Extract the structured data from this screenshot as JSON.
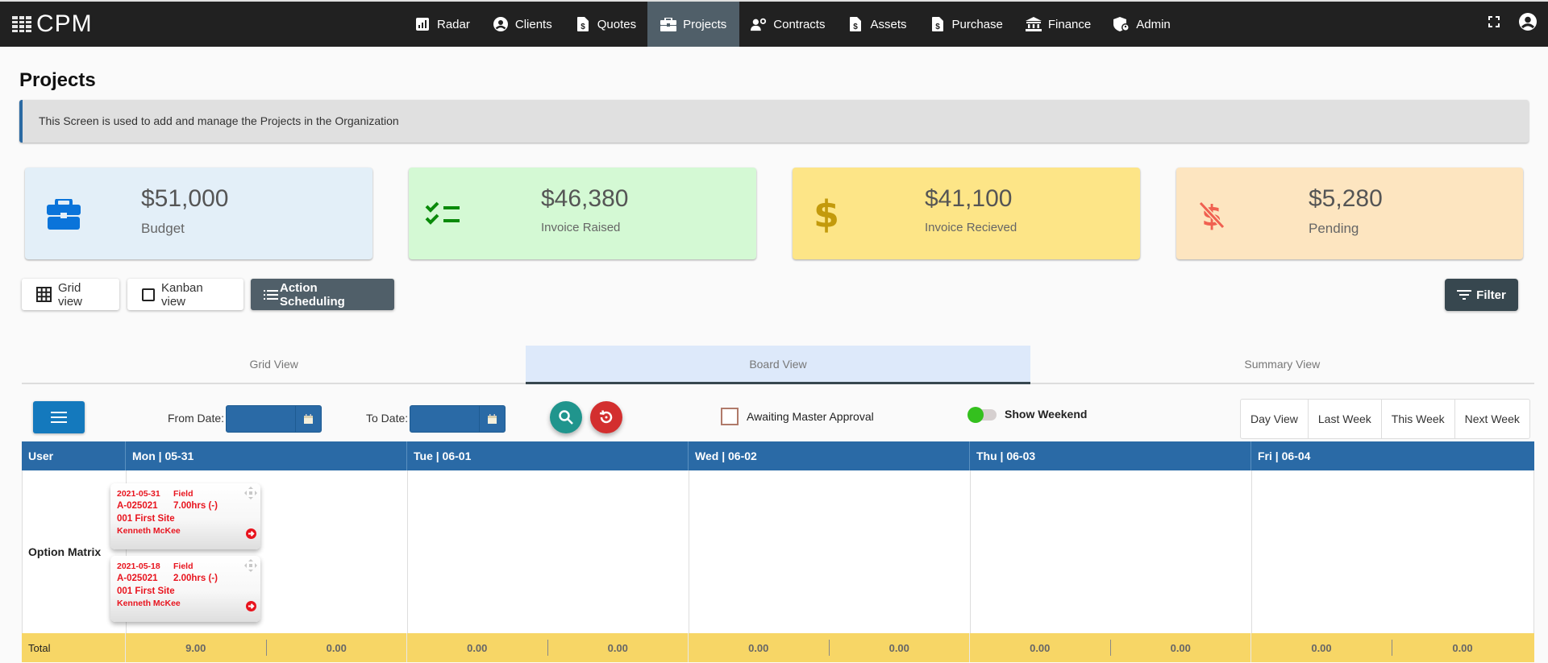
{
  "app": {
    "logo_text": "CPM"
  },
  "nav": {
    "items": [
      {
        "label": "Radar",
        "icon": "chart-icon"
      },
      {
        "label": "Clients",
        "icon": "user-circle-icon"
      },
      {
        "label": "Quotes",
        "icon": "invoice-dollar-icon"
      },
      {
        "label": "Projects",
        "icon": "briefcase-icon",
        "active": true
      },
      {
        "label": "Contracts",
        "icon": "users-cog-icon"
      },
      {
        "label": "Assets",
        "icon": "invoice-dollar-icon"
      },
      {
        "label": "Purchase",
        "icon": "invoice-dollar-icon"
      },
      {
        "label": "Finance",
        "icon": "bank-icon"
      },
      {
        "label": "Admin",
        "icon": "shield-user-icon"
      }
    ],
    "right": {
      "fullscreen_icon": "fullscreen-icon",
      "account_icon": "user-circle-icon"
    }
  },
  "page": {
    "title": "Projects",
    "info": "This Screen is used to add and manage the Projects in the Organization"
  },
  "stats": [
    {
      "value": "$51,000",
      "label": "Budget",
      "icon": "briefcase-icon",
      "color": "#0a74da"
    },
    {
      "value": "$46,380",
      "label": "Invoice Raised",
      "icon": "tasks-icon",
      "color": "#0a8a0a"
    },
    {
      "value": "$41,100",
      "label": "Invoice Recieved",
      "icon": "dollar-icon",
      "color": "#c39a0c"
    },
    {
      "value": "$5,280",
      "label": "Pending",
      "icon": "no-dollar-icon",
      "color": "#f06050"
    }
  ],
  "view_buttons": {
    "grid": "Grid view",
    "kanban": "Kanban view",
    "action": "Action Scheduling",
    "filter": "Filter"
  },
  "tabs": [
    {
      "label": "Grid View",
      "active": false
    },
    {
      "label": "Board View",
      "active": true
    },
    {
      "label": "Summary View",
      "active": false
    }
  ],
  "toolbar": {
    "from_date_label": "From Date:",
    "from_date_value": "",
    "to_date_label": "To Date:",
    "to_date_value": "",
    "awaiting_label": "Awaiting Master Approval",
    "awaiting_checked": false,
    "weekend_label": "Show Weekend",
    "weekend_on": true,
    "range_buttons": [
      "Day View",
      "Last Week",
      "This Week",
      "Next Week"
    ]
  },
  "schedule": {
    "headers": [
      "User",
      "Mon | 05-31",
      "Tue | 06-01",
      "Wed | 06-02",
      "Thu | 06-03",
      "Fri | 06-04"
    ],
    "rows": [
      {
        "user": "Option Matrix",
        "tasks": [
          {
            "date": "2021-05-31",
            "type": "Field",
            "code": "A-025021",
            "hours": "7.00hrs (-)",
            "site": "001 First Site",
            "person": "Kenneth McKee"
          },
          {
            "date": "2021-05-18",
            "type": "Field",
            "code": "A-025021",
            "hours": "2.00hrs (-)",
            "site": "001 First Site",
            "person": "Kenneth McKee"
          }
        ]
      }
    ],
    "total_label": "Total",
    "totals": [
      [
        "9.00",
        "0.00"
      ],
      [
        "0.00",
        "0.00"
      ],
      [
        "0.00",
        "0.00"
      ],
      [
        "0.00",
        "0.00"
      ],
      [
        "0.00",
        "0.00"
      ]
    ]
  }
}
